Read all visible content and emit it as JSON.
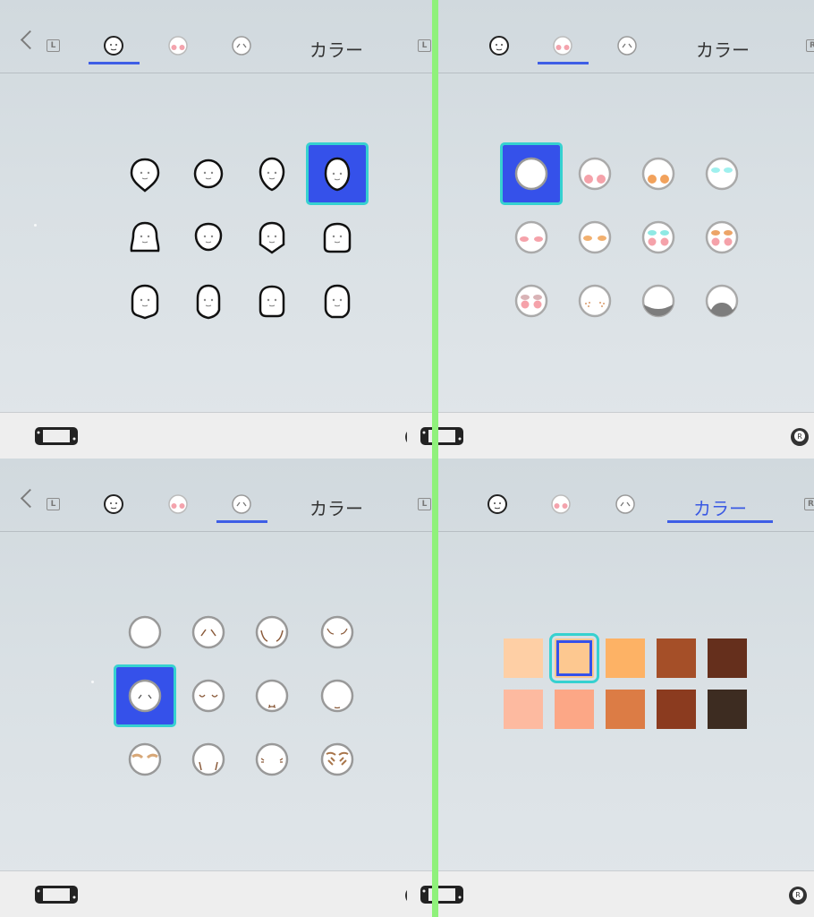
{
  "header": {
    "l_button": "L",
    "r_button": "R",
    "color_tab_label": "カラー"
  },
  "panels": [
    {
      "id": "face-shape",
      "active_tab": "face-shape",
      "selected_index": 3
    },
    {
      "id": "face-makeup",
      "active_tab": "makeup",
      "selected_index": 0
    },
    {
      "id": "face-wrinkles",
      "active_tab": "wrinkles",
      "selected_index": 4
    },
    {
      "id": "skin-color",
      "active_tab": "color",
      "selected_index": 1
    }
  ],
  "skin_colors": [
    "#fecfa5",
    "#fdc890",
    "#fdb265",
    "#a54f28",
    "#652f1c",
    "#fdbaa0",
    "#fca786",
    "#dc7c45",
    "#8b3b1f",
    "#3d2c21"
  ],
  "accent_color": "#3a59e3",
  "selection_color": "#36d1d0"
}
